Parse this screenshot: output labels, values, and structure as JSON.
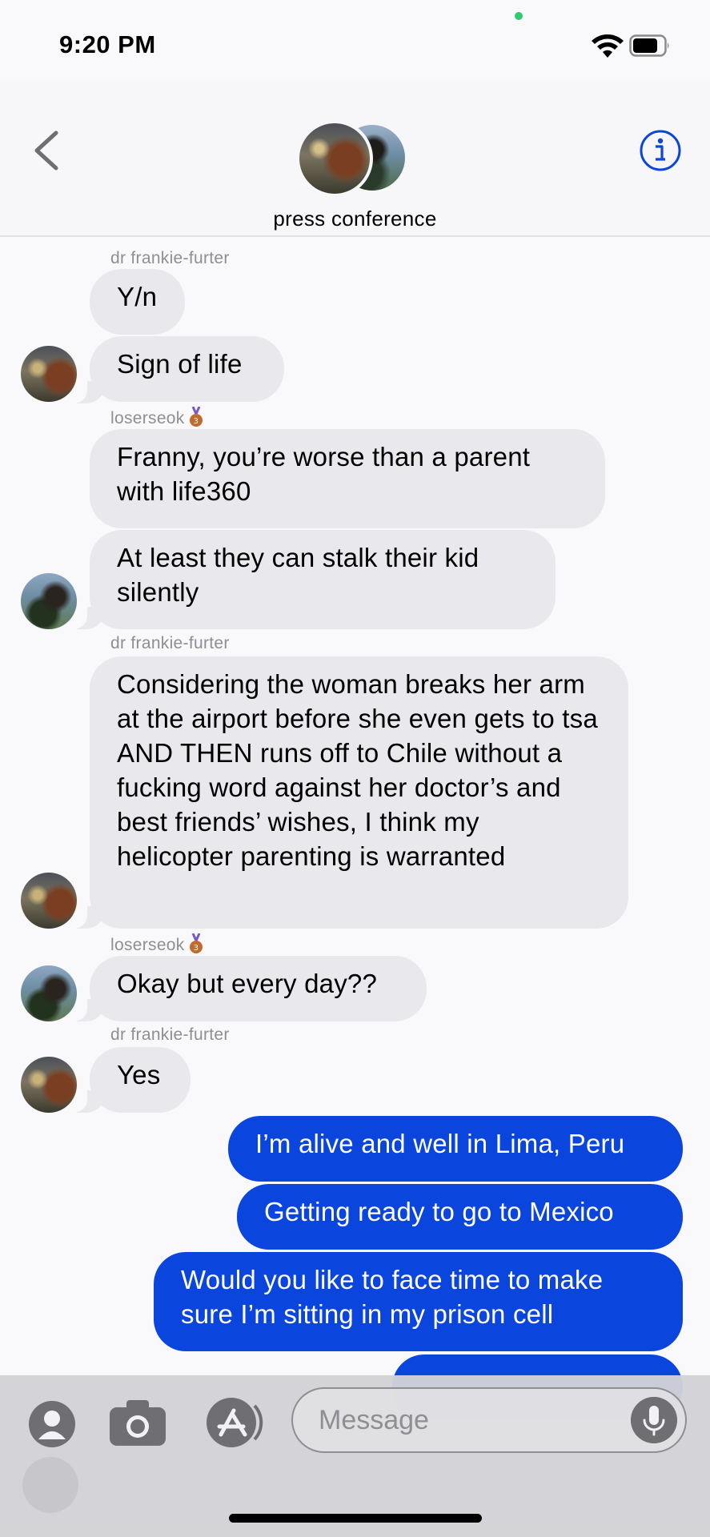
{
  "status_bar": {
    "time": "9:20 PM"
  },
  "header": {
    "group_name": "press conference"
  },
  "messages": [
    {
      "sender": "dr frankie-furter",
      "text": "Y/n"
    },
    {
      "text": "Sign of life"
    },
    {
      "sender": "loserseok",
      "text": "Franny, you’re worse than a parent with life360"
    },
    {
      "text": "At least they can stalk their kid silently"
    },
    {
      "sender": "dr frankie-furter",
      "text": "Considering the woman breaks her arm at the airport before she even gets to tsa AND THEN runs off to Chile without a fucking word against her doctor’s and best friends’ wishes, I think my helicopter parenting is warranted"
    },
    {
      "sender": "loserseok",
      "text": "Okay but every day??"
    },
    {
      "sender": "dr frankie-furter",
      "text": "Yes"
    },
    {
      "text": "I’m alive and well in Lima, Peru"
    },
    {
      "text": "Getting ready to go to Mexico"
    },
    {
      "text": "Would you like to face time to make sure I’m sitting in my prison cell"
    }
  ],
  "composer": {
    "placeholder": "Message"
  },
  "colors": {
    "outgoing": "#0a45dd",
    "incoming": "#e9e8ed",
    "accent": "#0a45dd"
  }
}
